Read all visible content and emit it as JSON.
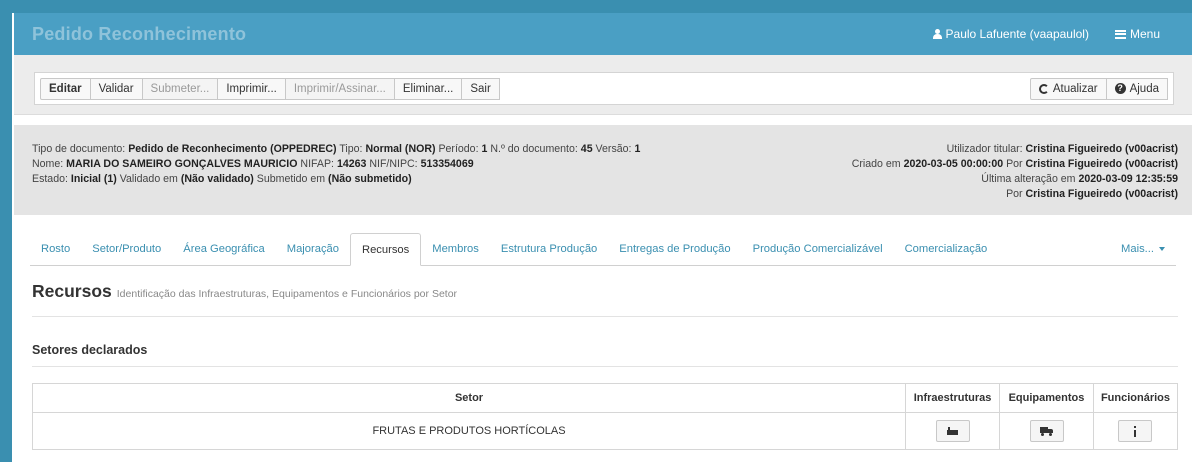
{
  "header": {
    "title": "Pedido Reconhecimento",
    "user": "Paulo Lafuente (vaapaulol)",
    "menu_label": "Menu"
  },
  "toolbar": {
    "buttons": [
      {
        "label": "Editar",
        "state": "primary"
      },
      {
        "label": "Validar",
        "state": "enabled"
      },
      {
        "label": "Submeter...",
        "state": "disabled"
      },
      {
        "label": "Imprimir...",
        "state": "enabled"
      },
      {
        "label": "Imprimir/Assinar...",
        "state": "disabled"
      },
      {
        "label": "Eliminar...",
        "state": "enabled"
      },
      {
        "label": "Sair",
        "state": "enabled"
      }
    ],
    "refresh_label": "Atualizar",
    "help_label": "Ajuda"
  },
  "info": {
    "lbl_tipo_doc": "Tipo de documento:",
    "tipo_doc": "Pedido de Reconhecimento (OPPEDREC)",
    "lbl_tipo": "Tipo:",
    "tipo": "Normal (NOR)",
    "lbl_periodo": "Período:",
    "periodo": "1",
    "lbl_num_doc": "N.º do documento:",
    "num_doc": "45",
    "lbl_versao": "Versão:",
    "versao": "1",
    "lbl_nome": "Nome:",
    "nome": "MARIA DO SAMEIRO GONÇALVES MAURICIO",
    "lbl_nifap": "NIFAP:",
    "nifap": "14263",
    "lbl_nif": "NIF/NIPC:",
    "nif": "513354069",
    "lbl_estado": "Estado:",
    "estado": "Inicial (1)",
    "lbl_validado": "Validado em",
    "validado": "(Não validado)",
    "lbl_submetido": "Submetido em",
    "submetido": "(Não submetido)",
    "lbl_titular": "Utilizador titular:",
    "titular": "Cristina Figueiredo (v00acrist)",
    "lbl_criado": "Criado em",
    "criado_em": "2020-03-05 00:00:00",
    "lbl_por": "Por",
    "criado_por": "Cristina Figueiredo (v00acrist)",
    "lbl_alteracao": "Última alteração em",
    "alteracao_em": "2020-03-09 12:35:59",
    "alteracao_por": "Cristina Figueiredo (v00acrist)"
  },
  "tabs": [
    {
      "label": "Rosto",
      "active": false
    },
    {
      "label": "Setor/Produto",
      "active": false
    },
    {
      "label": "Área Geográfica",
      "active": false
    },
    {
      "label": "Majoração",
      "active": false
    },
    {
      "label": "Recursos",
      "active": true
    },
    {
      "label": "Membros",
      "active": false
    },
    {
      "label": "Estrutura Produção",
      "active": false
    },
    {
      "label": "Entregas de Produção",
      "active": false
    },
    {
      "label": "Produção Comercializável",
      "active": false
    },
    {
      "label": "Comercialização",
      "active": false
    }
  ],
  "more_label": "Mais...",
  "section": {
    "title": "Recursos",
    "subtitle": "Identificação das Infraestruturas, Equipamentos e Funcionários por Setor",
    "subsection": "Setores declarados"
  },
  "table": {
    "headers": [
      "Setor",
      "Infraestruturas",
      "Equipamentos",
      "Funcionários"
    ],
    "rows": [
      {
        "setor": "FRUTAS E PRODUTOS HORTÍCOLAS"
      }
    ]
  },
  "icons": {
    "user": "user-icon",
    "menu": "list-icon",
    "refresh": "refresh-icon",
    "help": "question-circle-icon",
    "infra": "industry-icon",
    "equip": "truck-icon",
    "staff": "info-icon"
  },
  "colors": {
    "header_bg": "#4a9fc4",
    "accent": "#3a8fb0",
    "info_bg": "#e4e4e4"
  }
}
